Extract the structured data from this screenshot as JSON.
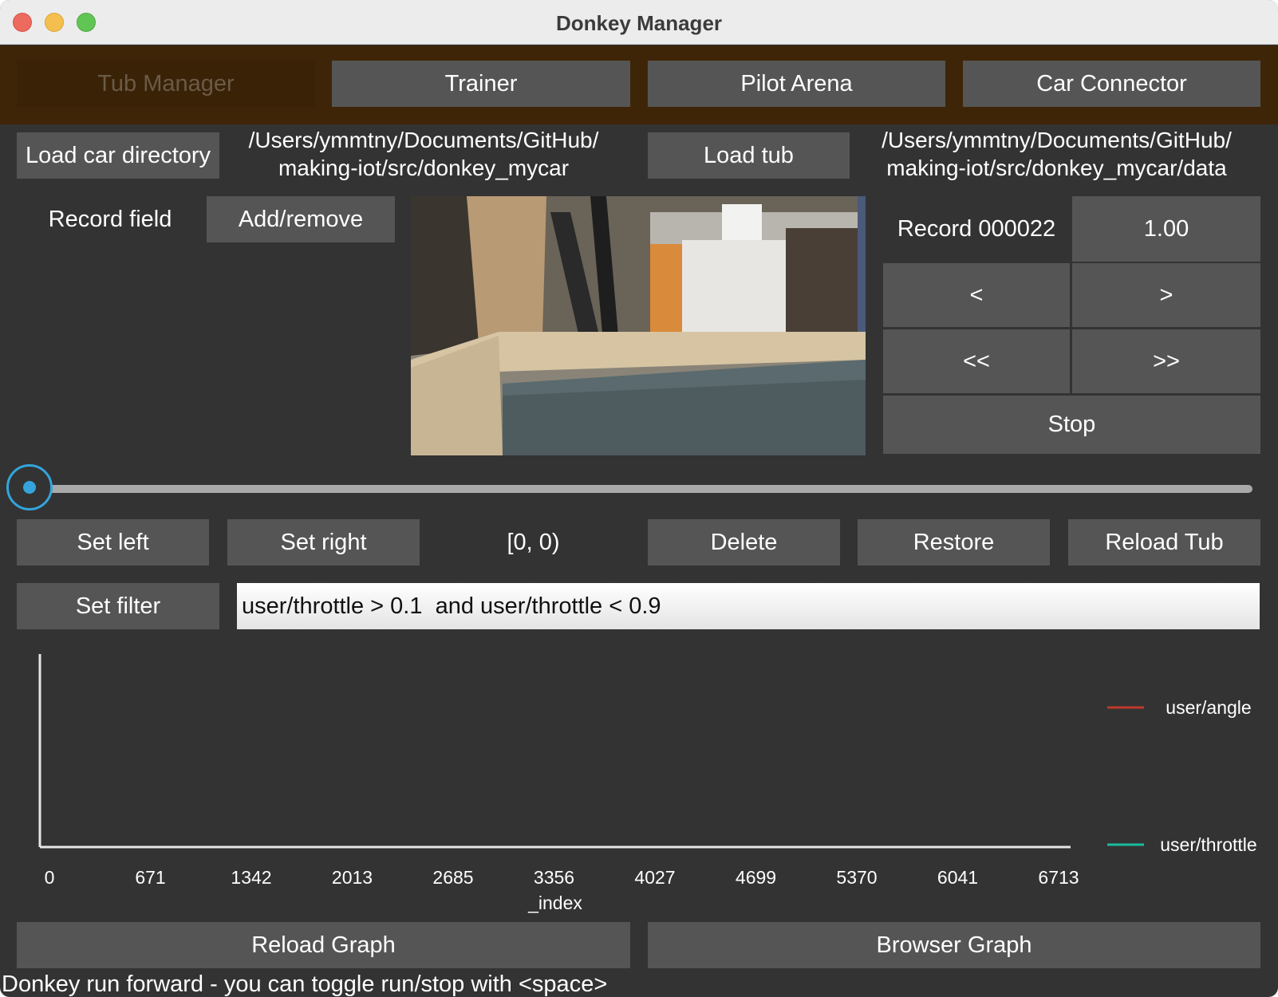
{
  "window": {
    "title": "Donkey Manager"
  },
  "tabs": [
    {
      "label": "Tub Manager",
      "active": true
    },
    {
      "label": "Trainer"
    },
    {
      "label": "Pilot Arena"
    },
    {
      "label": "Car Connector"
    }
  ],
  "car_dir": {
    "button": "Load car directory",
    "path_line1": "/Users/ymmtny/Documents/GitHub/",
    "path_line2": "making-iot/src/donkey_mycar"
  },
  "tub": {
    "button": "Load tub",
    "path_line1": "/Users/ymmtny/Documents/GitHub/",
    "path_line2": "making-iot/src/donkey_mycar/data"
  },
  "record_field": {
    "label": "Record field",
    "button": "Add/remove"
  },
  "record": {
    "label": "Record 000022",
    "speed": "1.00",
    "prev": "<",
    "next": ">",
    "rewind": "<<",
    "forward": ">>",
    "stop": "Stop"
  },
  "slider": {
    "value": 0
  },
  "selection": {
    "set_left": "Set left",
    "set_right": "Set right",
    "range": "[0, 0)",
    "delete": "Delete",
    "restore": "Restore",
    "reload_tub": "Reload Tub"
  },
  "filter": {
    "button": "Set filter",
    "expression": "user/throttle > 0.1  and user/throttle < 0.9"
  },
  "graph": {
    "reload": "Reload Graph",
    "browser": "Browser Graph"
  },
  "chart_data": {
    "type": "line",
    "xlabel": "_index",
    "ylabel": "",
    "x_ticks": [
      "0",
      "671",
      "1342",
      "2013",
      "2685",
      "3356",
      "4027",
      "4699",
      "5370",
      "6041",
      "6713"
    ],
    "xlim": [
      0,
      6713
    ],
    "legend": "right",
    "series": [
      {
        "name": "user/angle",
        "color": "#c0392b",
        "values": []
      },
      {
        "name": "user/throttle",
        "color": "#1abc9c",
        "values": []
      }
    ]
  },
  "status": "Donkey run forward - you can toggle run/stop with <space>",
  "colors": {
    "accent": "#33a5dc",
    "tabbar": "#3f2508",
    "button": "#555555",
    "background": "#333333"
  }
}
